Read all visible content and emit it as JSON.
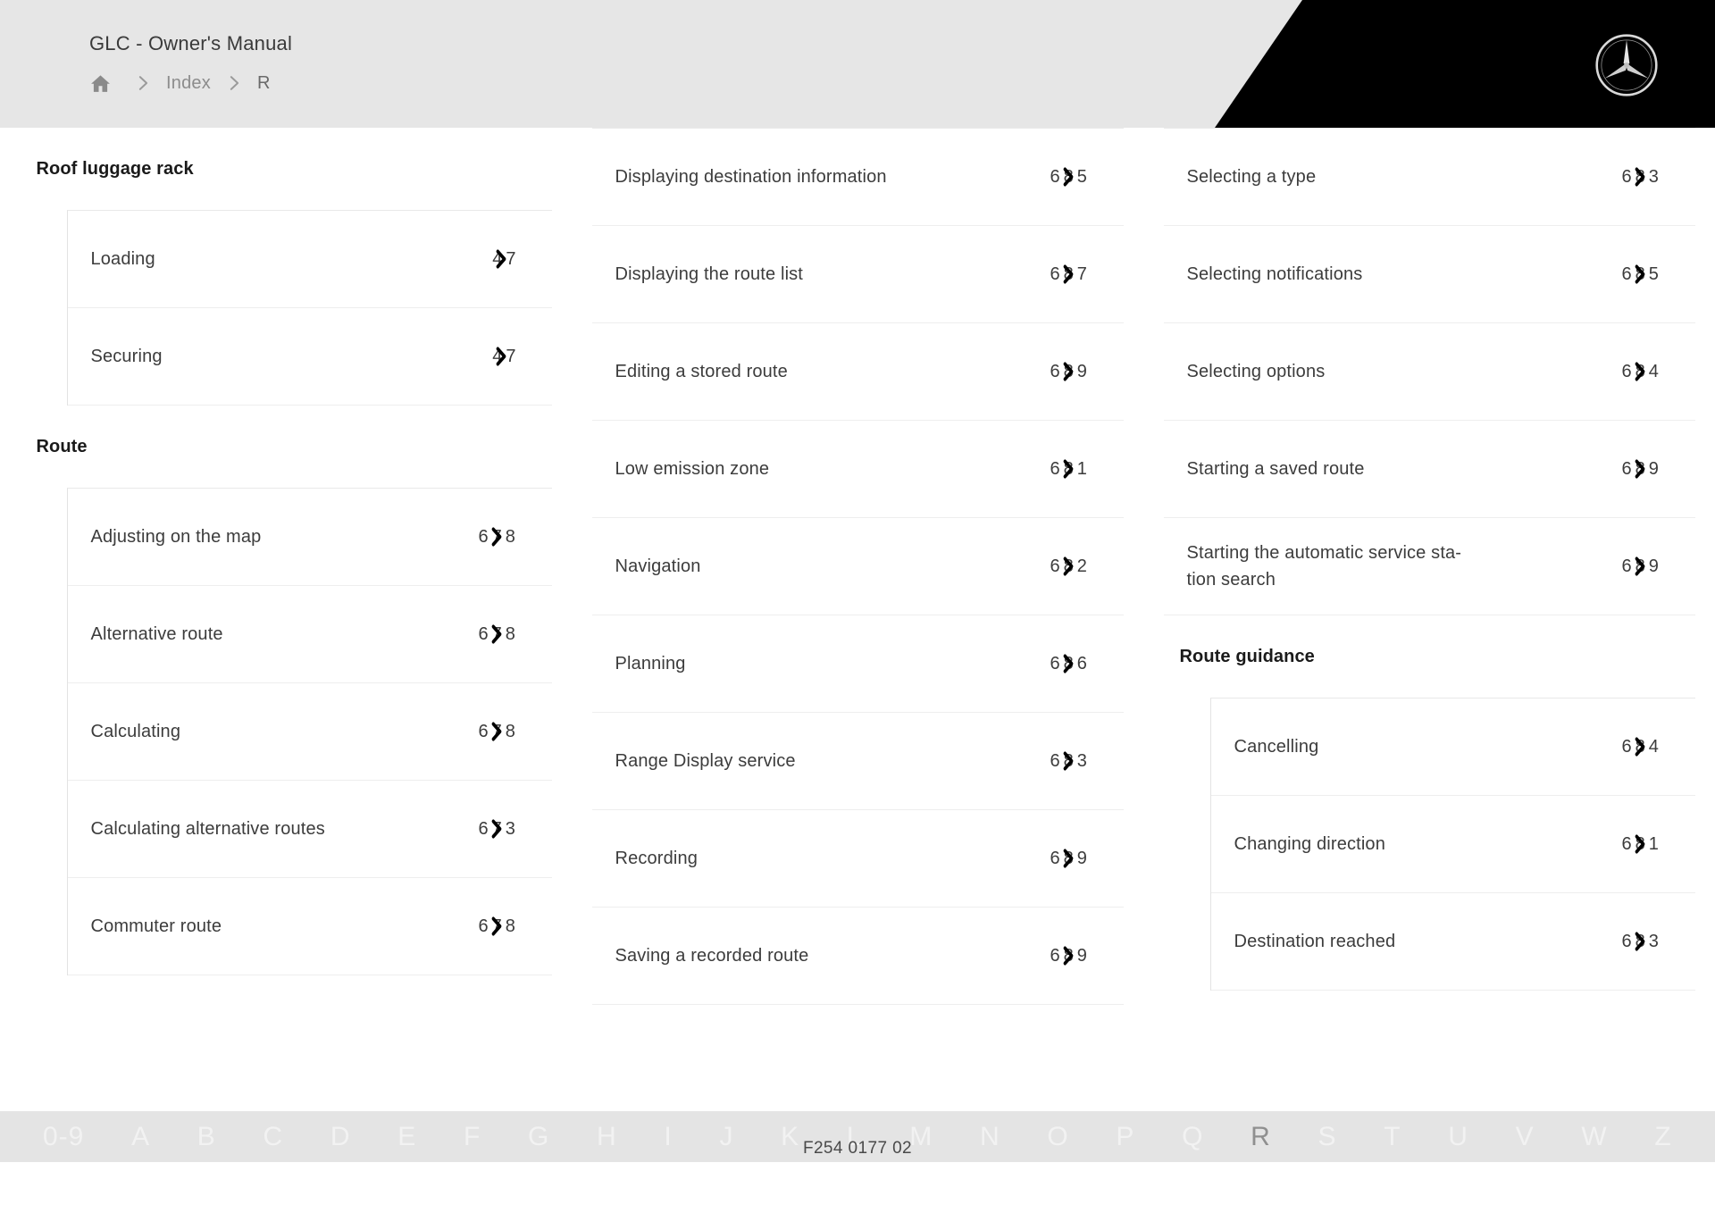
{
  "header": {
    "title": "GLC - Owner's Manual",
    "home_icon": "home-icon",
    "breadcrumb": [
      {
        "label": "Index",
        "current": false
      },
      {
        "label": "R",
        "current": true
      }
    ],
    "logo": "mercedes-benz-star-logo",
    "accent_black": "#000000",
    "bar_bg": "#e6e6e6"
  },
  "index": {
    "columns": [
      {
        "groups": [
          {
            "title": "Roof luggage rack",
            "entries": [
              {
                "label": "Loading",
                "page": "47",
                "short": true
              },
              {
                "label": "Securing",
                "page": "47",
                "short": true
              }
            ]
          },
          {
            "title": "Route",
            "entries": [
              {
                "label": "Adjusting on the map",
                "page": "678",
                "short": false
              },
              {
                "label": "Alternative route",
                "page": "678",
                "short": false
              },
              {
                "label": "Calculating",
                "page": "678",
                "short": false
              },
              {
                "label": "Calculating alternative routes",
                "page": "673",
                "short": false
              },
              {
                "label": "Commuter route",
                "page": "678",
                "short": false
              }
            ]
          }
        ]
      },
      {
        "groups": [
          {
            "title": "",
            "entries": [
              {
                "label": "Displaying destination information",
                "page": "685",
                "short": false
              },
              {
                "label": "Displaying the route list",
                "page": "687",
                "short": false
              },
              {
                "label": "Editing a stored route",
                "page": "689",
                "short": false
              },
              {
                "label": "Low emission zone",
                "page": "681",
                "short": false
              },
              {
                "label": "Navigation",
                "page": "682",
                "short": false
              },
              {
                "label": "Planning",
                "page": "686",
                "short": false
              },
              {
                "label": "Range Display service",
                "page": "683",
                "short": false
              },
              {
                "label": "Recording",
                "page": "689",
                "short": false
              },
              {
                "label": "Saving a recorded route",
                "page": "689",
                "short": false
              }
            ]
          }
        ]
      },
      {
        "groups": [
          {
            "title": "",
            "entries": [
              {
                "label": "Selecting a type",
                "page": "683",
                "short": false
              },
              {
                "label": "Selecting notifications",
                "page": "685",
                "short": false
              },
              {
                "label": "Selecting options",
                "page": "684",
                "short": false
              },
              {
                "label": "Starting a saved route",
                "page": "689",
                "short": false
              },
              {
                "label": "Starting the automatic service sta-\ntion search",
                "page": "689",
                "short": false
              }
            ]
          },
          {
            "title": "Route guidance",
            "entries": [
              {
                "label": "Cancelling",
                "page": "684",
                "short": false
              },
              {
                "label": "Changing direction",
                "page": "681",
                "short": false
              },
              {
                "label": "Destination reached",
                "page": "683",
                "short": false
              }
            ]
          }
        ]
      }
    ]
  },
  "footer": {
    "letters": [
      "0-9",
      "A",
      "B",
      "C",
      "D",
      "E",
      "F",
      "G",
      "H",
      "I",
      "J",
      "K",
      "L",
      "M",
      "N",
      "O",
      "P",
      "Q",
      "R",
      "S",
      "T",
      "U",
      "V",
      "W",
      "Z"
    ],
    "active_letter": "R",
    "code": "F254 0177 02",
    "bar_bg": "#e4e4e4"
  }
}
